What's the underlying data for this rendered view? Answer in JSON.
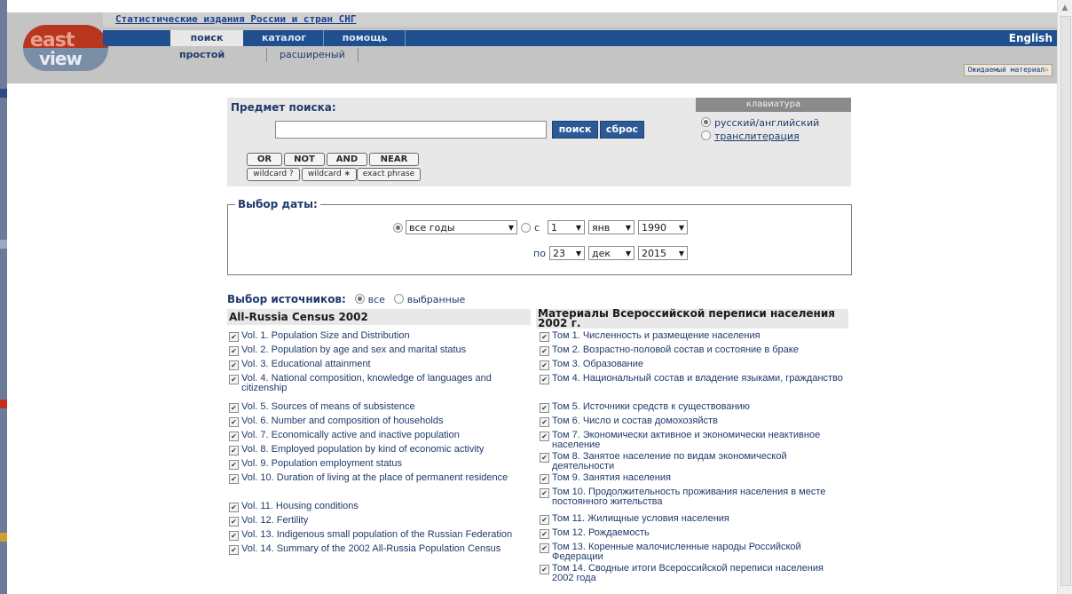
{
  "header": {
    "site_title": "Статистические издания России и стран СНГ",
    "logo_text_top": "east",
    "logo_text_bottom": "view",
    "nav_tabs": [
      "поиск",
      "каталог",
      "помощь"
    ],
    "language_link": "English",
    "sub_tabs": [
      "простой",
      "расширеный"
    ],
    "expected_material": "Ожидаемый материал",
    "expected_arrow": "»"
  },
  "search": {
    "label": "Предмет поиска:",
    "input_value": "",
    "search_button": "поиск",
    "reset_button": "сброс",
    "keyboard_header": "клавиатура",
    "keyboard_options": [
      "русский/английский",
      "транслитерация"
    ],
    "keyboard_selected": "русский/английский",
    "operators": [
      "OR",
      "NOT",
      "AND",
      "NEAR"
    ],
    "wildcards": [
      "wildcard ?",
      "wildcard ∗",
      "exact phrase"
    ]
  },
  "date": {
    "legend": "Выбор даты:",
    "all_years": "все годы",
    "from_label": "с",
    "from_day": "1",
    "from_month": "янв",
    "from_year": "1990",
    "to_label": "по",
    "to_day": "23",
    "to_month": "дек",
    "to_year": "2015",
    "selected": "все годы"
  },
  "sources": {
    "label": "Выбор источников:",
    "options": [
      "все",
      "выбранные"
    ],
    "selected": "все",
    "left_column_title": "All-Russia Census 2002",
    "right_column_title": "Материалы Всероссийской переписи населения 2002 г.",
    "left_items": [
      "Vol. 1. Population Size and Distribution",
      "Vol. 2. Population by age and sex and marital status",
      "Vol. 3. Educational attainment",
      "Vol. 4. National composition, knowledge of languages and citizenship",
      "Vol. 5. Sources of means of subsistence",
      "Vol. 6. Number and composition of households",
      "Vol. 7. Economically active and inactive population",
      "Vol. 8. Employed population by kind of economic activity",
      "Vol. 9. Population employment status",
      "Vol. 10. Duration of living at the place of permanent residence",
      "Vol. 11. Housing conditions",
      "Vol. 12. Fertility",
      "Vol. 13. Indigenous small population of the Russian Federation",
      "Vol. 14. Summary of the 2002 All-Russia Population Census"
    ],
    "right_items": [
      "Том 1. Численность и размещение населения",
      "Том 2. Возрастно-половой состав и состояние в браке",
      "Том 3. Образование",
      "Том 4. Национальный состав и владение языками, гражданство",
      "Том 5. Источники средств к существованию",
      "Том 6. Число и состав домохозяйств",
      "Том 7. Экономически активное и экономически неактивное население",
      "Том 8. Занятое население по видам экономической деятельности",
      "Том 9. Занятия населения",
      "Том 10. Продолжительность проживания населения в месте постоянного жительства",
      "Том 11. Жилищные условия населения",
      "Том 12. Рождаемость",
      "Том 13. Коренные малочисленные народы Российской Федерации",
      "Том 14. Сводные итоги Всероссийской переписи населения 2002 года"
    ],
    "checkbox_mark": "✔"
  },
  "colors": {
    "nav_blue": "#1f4f8f",
    "header_gray": "#c4c4c4",
    "logo_red": "#b8361f",
    "text_blue": "#1f3a6b"
  }
}
